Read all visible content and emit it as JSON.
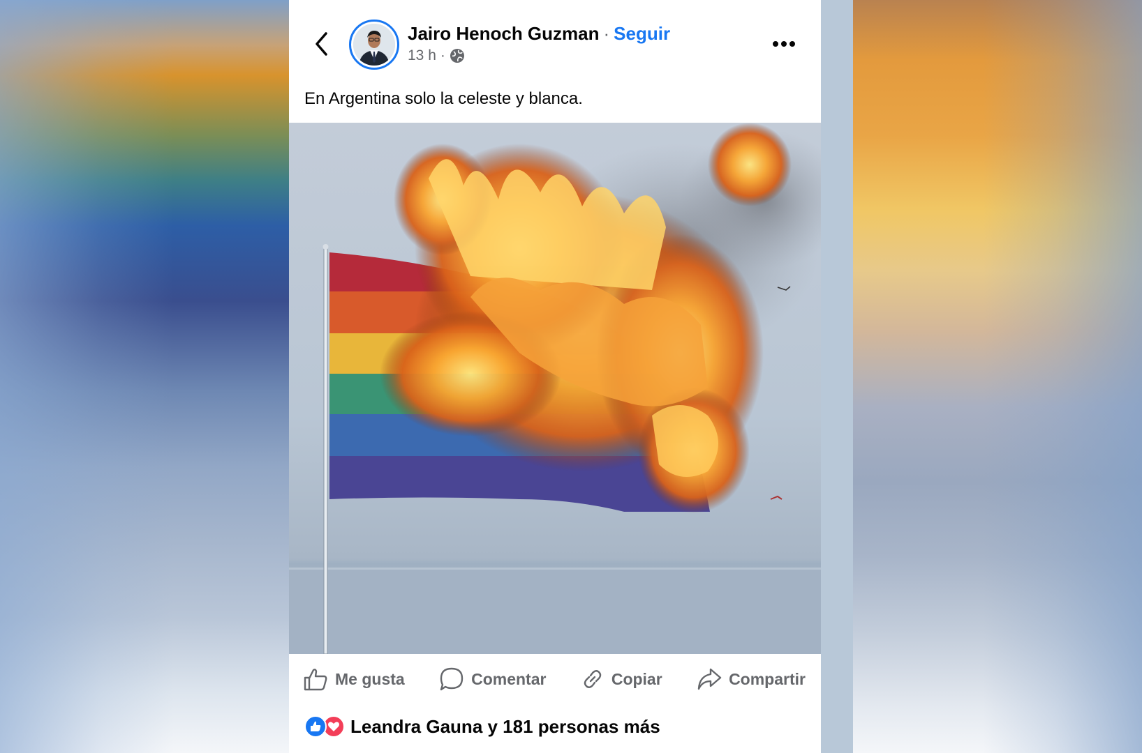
{
  "post": {
    "author": {
      "name": "Jairo Henoch Guzman",
      "separator": "·",
      "follow_label": "Seguir"
    },
    "meta": {
      "time": "13 h",
      "dot": "·",
      "visibility_icon": "globe-icon"
    },
    "caption": "En Argentina solo la celeste y blanca.",
    "image": {
      "description_icon": "burning-rainbow-flag-photo"
    },
    "actions": {
      "like": {
        "label": "Me gusta",
        "icon": "thumbs-up-icon"
      },
      "comment": {
        "label": "Comentar",
        "icon": "comment-bubble-icon"
      },
      "copy": {
        "label": "Copiar",
        "icon": "link-icon"
      },
      "share": {
        "label": "Compartir",
        "icon": "share-arrow-icon"
      }
    },
    "reactions": {
      "summary": "Leandra Gauna y 181 personas más",
      "icons": [
        "like-reaction-icon",
        "love-reaction-icon"
      ]
    }
  },
  "colors": {
    "accent": "#1877f2",
    "text": "#050505",
    "secondary_text": "#65676b",
    "love": "#f33e58"
  }
}
